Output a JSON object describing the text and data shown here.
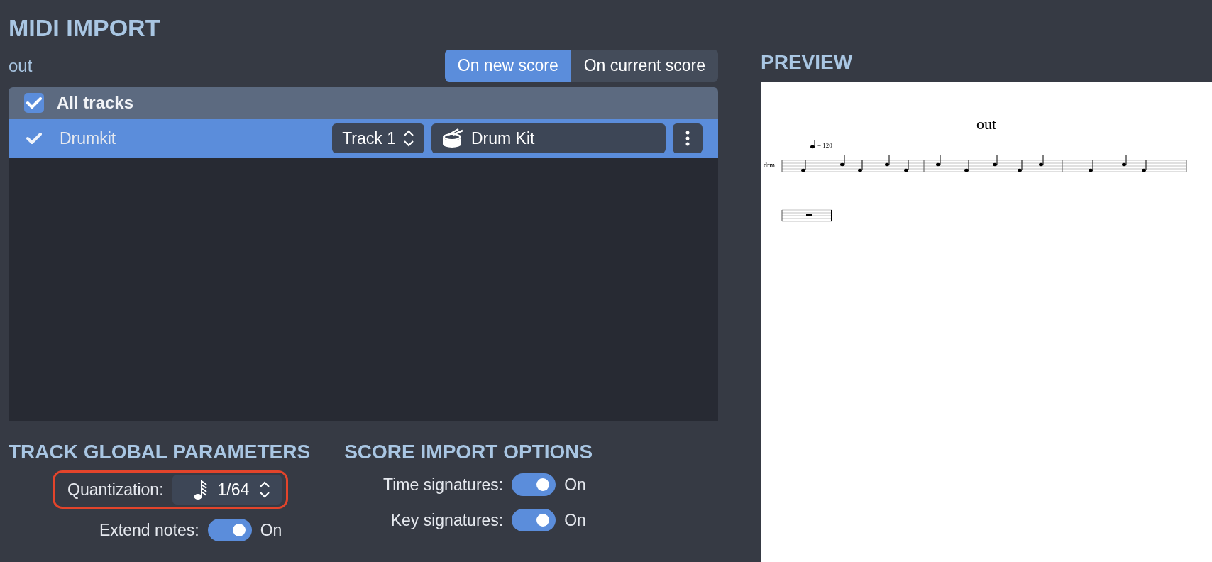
{
  "title": "MIDI IMPORT",
  "file_name": "out",
  "import_target": [
    {
      "label": "On new score",
      "selected": true
    },
    {
      "label": "On current score",
      "selected": false
    }
  ],
  "tracks_header": {
    "label": "All tracks",
    "checked": true
  },
  "tracks": [
    {
      "name": "Drumkit",
      "checked": true,
      "selected": true,
      "track": "Track 1",
      "instrument": "Drum Kit"
    }
  ],
  "track_global_parameters": {
    "title": "TRACK GLOBAL PARAMETERS",
    "rows": [
      {
        "label": "Quantization:",
        "kind": "select",
        "value": "1/64",
        "highlighted": true
      },
      {
        "label": "Extend notes:",
        "kind": "toggle",
        "on": true,
        "value": "On",
        "highlighted": false
      }
    ]
  },
  "score_import_options": {
    "title": "SCORE IMPORT OPTIONS",
    "rows": [
      {
        "label": "Time signatures:",
        "on": true,
        "value": "On"
      },
      {
        "label": "Key signatures:",
        "on": true,
        "value": "On"
      }
    ]
  },
  "preview": {
    "title": "PREVIEW",
    "score_title": "out",
    "tempo": "= 120",
    "instrument": "drm."
  }
}
